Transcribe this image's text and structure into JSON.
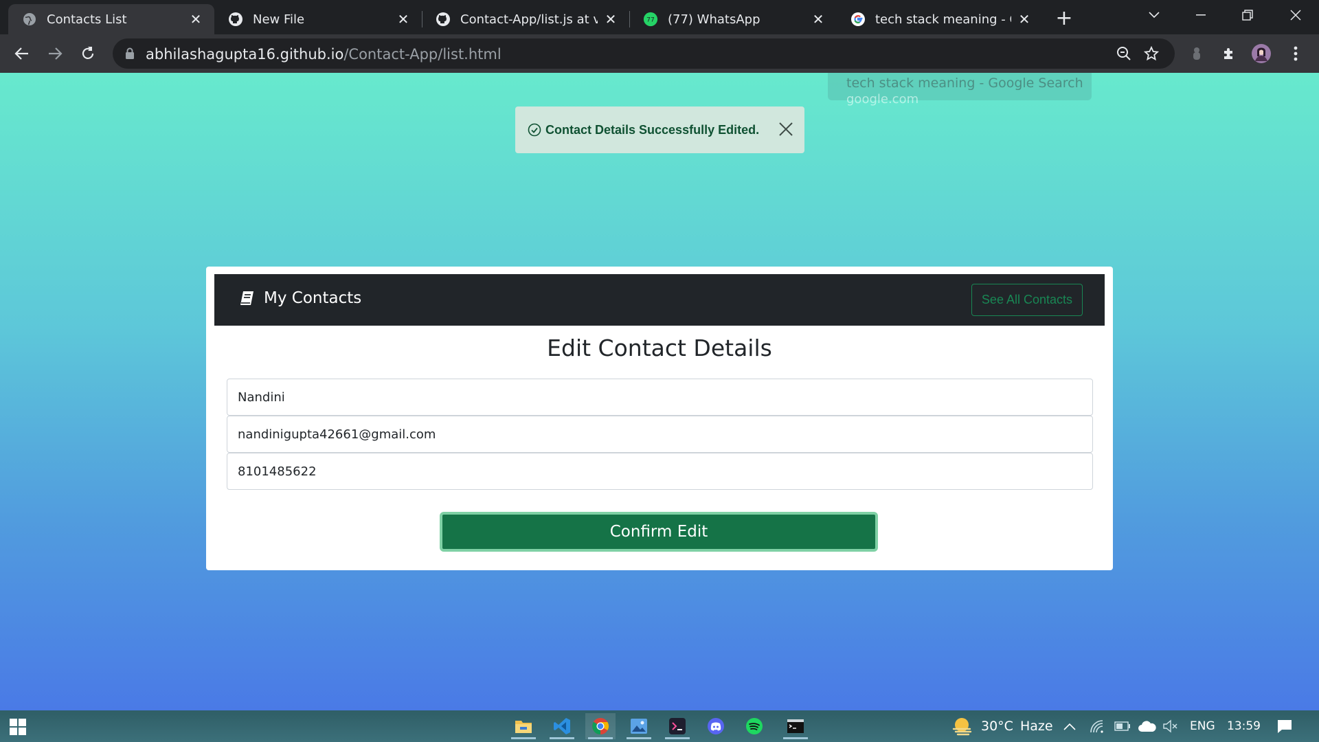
{
  "browser": {
    "tabs": [
      {
        "title": "Contacts List",
        "icon": "globe-icon",
        "active": true
      },
      {
        "title": "New File",
        "icon": "github-icon",
        "active": false
      },
      {
        "title": "Contact-App/list.js at vers",
        "icon": "github-icon",
        "active": false
      },
      {
        "title": "(77) WhatsApp",
        "icon": "whatsapp-icon",
        "active": false
      },
      {
        "title": "tech stack meaning - Goo",
        "icon": "google-icon",
        "active": false
      }
    ],
    "url_host": "abhilashagupta16.github.io",
    "url_path": "/Contact-App/list.html",
    "whatsapp_badge": "77"
  },
  "tooltip": {
    "title": "tech stack meaning - Google Search",
    "domain": "google.com"
  },
  "alert": {
    "message": "Contact Details Successfully Edited."
  },
  "app": {
    "brand": "My Contacts",
    "see_all_label": "See All Contacts",
    "heading": "Edit Contact Details",
    "fields": {
      "name": "Nandini",
      "email": "nandinigupta42661@gmail.com",
      "phone": "8101485622"
    },
    "confirm_label": "Confirm Edit"
  },
  "taskbar": {
    "weather_temp": "30°C",
    "weather_desc": "Haze",
    "language": "ENG",
    "time": "13:59"
  },
  "colors": {
    "success_green": "#198754",
    "alert_bg": "#d1e7dd",
    "alert_text": "#0f5132",
    "header_dark": "#212529",
    "gradient_top": "#67e9cd",
    "gradient_bottom": "#4a7ae6"
  }
}
